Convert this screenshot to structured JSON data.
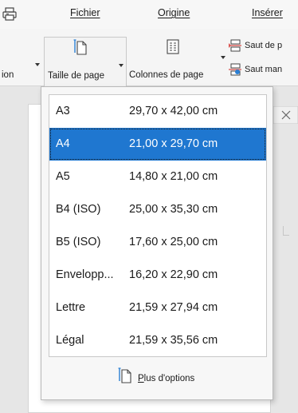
{
  "tabs": {
    "fichier": "Fichier",
    "origine": "Origine",
    "inserer": "Inserer"
  },
  "tabs_display": {
    "fichier": "Fichier",
    "origine": "Origine",
    "inserer": "Insérer"
  },
  "ribbon": {
    "partial_left_label": "ion",
    "page_size_label": "Taille de page",
    "columns_label": "Colonnes de page",
    "page_break_label": "Saut de p",
    "column_break_label": "Saut man"
  },
  "page_sizes": [
    {
      "name": "A3",
      "dims": "29,70 x 42,00 cm"
    },
    {
      "name": "A4",
      "dims": "21,00 x 29,70 cm"
    },
    {
      "name": "A5",
      "dims": "14,80 x 21,00 cm"
    },
    {
      "name": "B4 (ISO)",
      "dims": "25,00 x 35,30 cm"
    },
    {
      "name": "B5 (ISO)",
      "dims": "17,60 x 25,00 cm"
    },
    {
      "name": "Envelopp...",
      "dims": "16,20 x 22,90 cm"
    },
    {
      "name": "Lettre",
      "dims": "21,59 x 27,94 cm"
    },
    {
      "name": "Légal",
      "dims": "21,59 x 35,56 cm"
    }
  ],
  "selected_size": "A4",
  "more_options": {
    "access_key": "P",
    "label_rest": "lus d'options"
  },
  "colors": {
    "selection": "#1f77d0",
    "icon_accent": "#2a7fd4",
    "break_red": "#d9534f"
  }
}
